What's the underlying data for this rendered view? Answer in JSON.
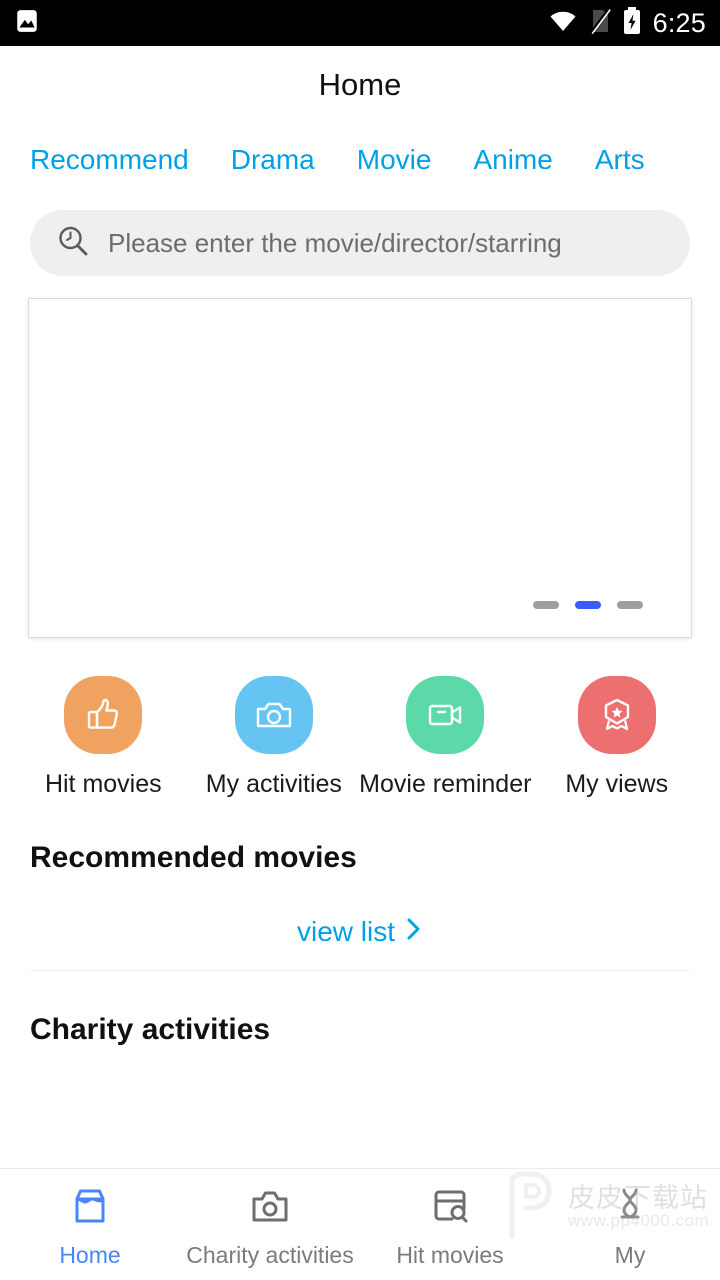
{
  "status_bar": {
    "notification_icon": "image-icon",
    "wifi_icon": "wifi-icon",
    "sim_icon": "sim-card-off-icon",
    "battery_icon": "battery-charging-icon",
    "time": "6:25"
  },
  "header": {
    "title": "Home"
  },
  "tabs": [
    {
      "label": "Recommend",
      "active": true
    },
    {
      "label": "Drama",
      "active": false
    },
    {
      "label": "Movie",
      "active": false
    },
    {
      "label": "Anime",
      "active": false
    },
    {
      "label": "Arts",
      "active": false
    }
  ],
  "search": {
    "icon": "search-icon",
    "placeholder": "Please enter the movie/director/starring",
    "value": ""
  },
  "carousel": {
    "slides_count": 3,
    "active_index": 1,
    "indicator_active_color": "#3b5bfb",
    "indicator_inactive_color": "#9e9e9e"
  },
  "quick_actions": [
    {
      "label": "Hit movies",
      "icon": "thumbs-up-icon",
      "color": "#f0a260"
    },
    {
      "label": "My activities",
      "icon": "camera-icon",
      "color": "#65c4f2"
    },
    {
      "label": "Movie reminder",
      "icon": "video-camera-icon",
      "color": "#5bd9a8"
    },
    {
      "label": "My views",
      "icon": "award-badge-icon",
      "color": "#ec7070"
    }
  ],
  "sections": {
    "recommended_movies_title": "Recommended movies",
    "view_list_label": "view list",
    "view_list_chevron": "chevron-right-icon",
    "charity_activities_title": "Charity activities"
  },
  "bottom_nav": [
    {
      "label": "Home",
      "icon": "archive-box-icon",
      "active": true
    },
    {
      "label": "Charity activities",
      "icon": "camera-icon",
      "active": false
    },
    {
      "label": "Hit movies",
      "icon": "window-search-icon",
      "active": false
    },
    {
      "label": "My",
      "icon": "person-icon",
      "active": false
    }
  ],
  "watermark": {
    "logo": "pp-logo-icon",
    "brand_cn": "皮皮下载站",
    "url": "www.pp4000.com"
  },
  "colors": {
    "accent_cyan": "#00a0e9",
    "nav_active_blue": "#4a86f7",
    "search_bg": "#efefef",
    "text_primary": "#111111",
    "text_muted": "#7b7b7b"
  }
}
